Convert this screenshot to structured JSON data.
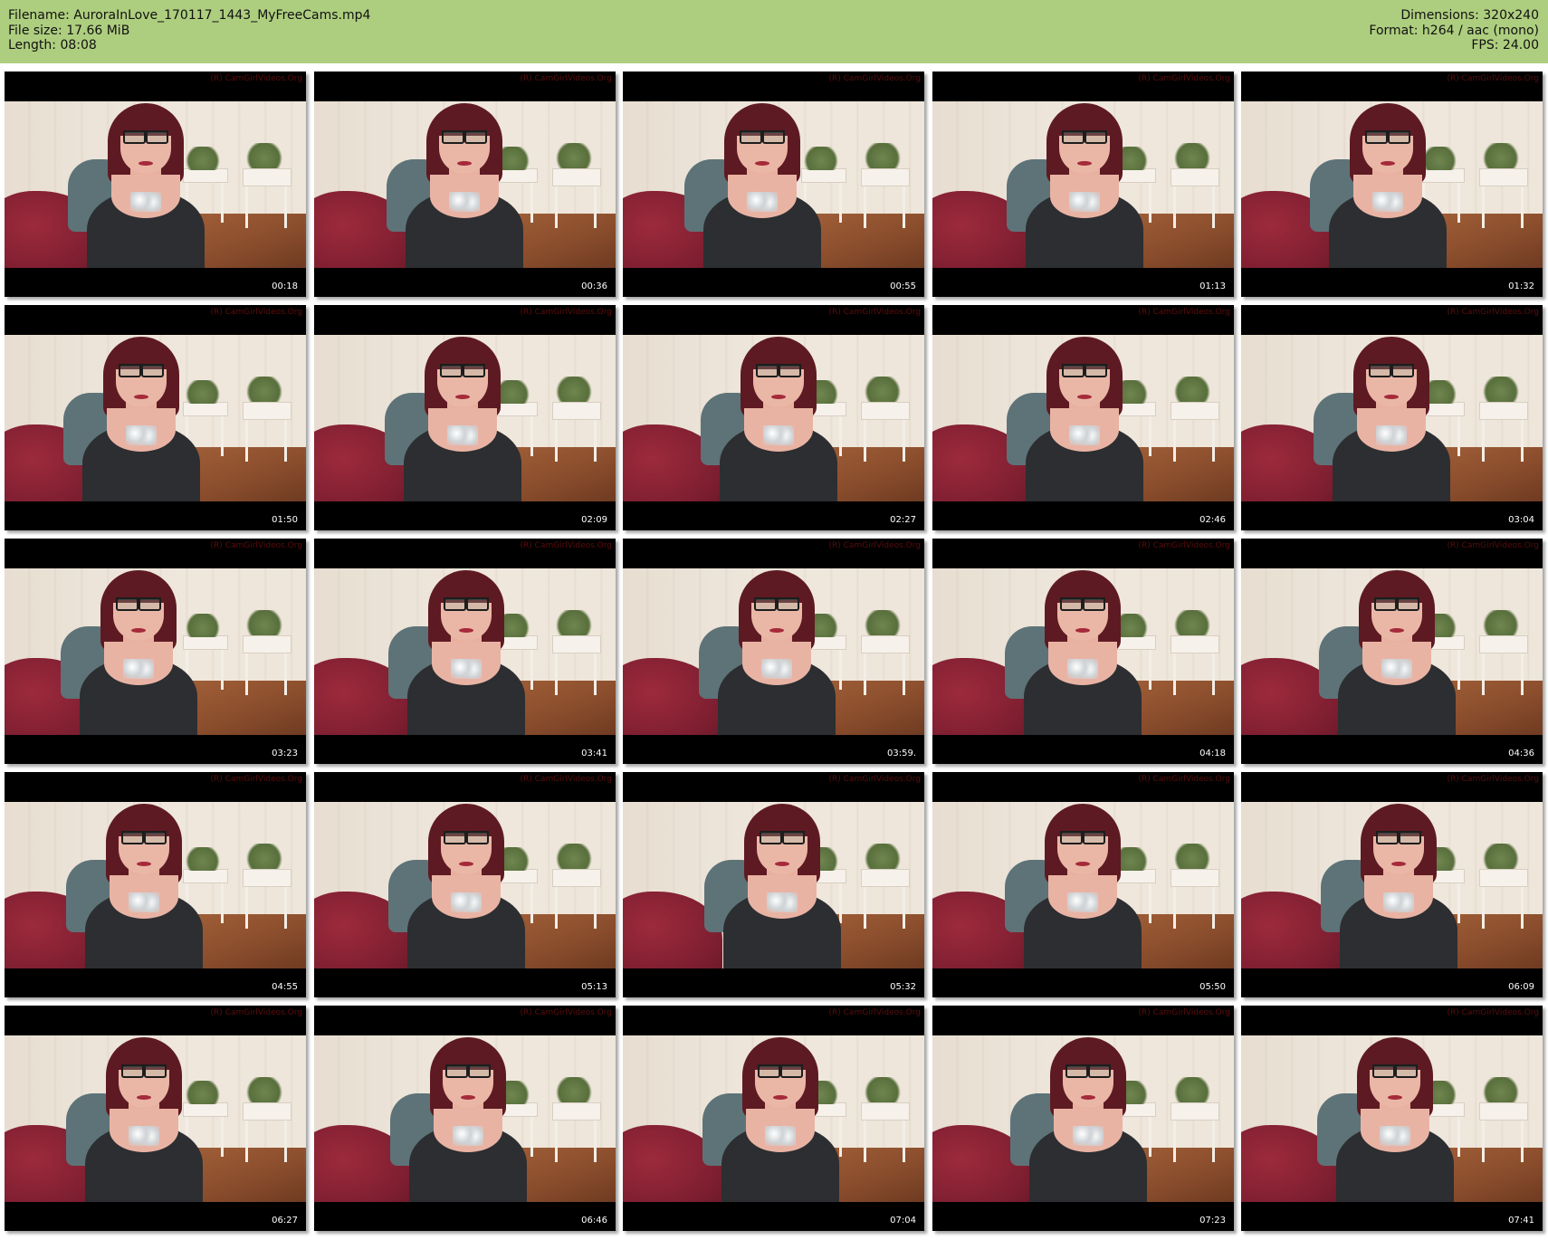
{
  "header": {
    "left": {
      "filename": "Filename: AuroraInLove_170117_1443_MyFreeCams.mp4",
      "filesize": "File size: 17.66 MiB",
      "length": "Length: 08:08"
    },
    "right": {
      "dimensions": "Dimensions: 320x240",
      "format": "Format: h264 / aac (mono)",
      "fps": "FPS: 24.00"
    },
    "background_color": "#aece7f"
  },
  "thumbnails": [
    {
      "time": "00:18",
      "watermark": "(R) CamGirlVideos.Org"
    },
    {
      "time": "00:36",
      "watermark": "(R) CamGirlVideos.Org"
    },
    {
      "time": "00:55",
      "watermark": "(R) CamGirlVideos.Org"
    },
    {
      "time": "01:13",
      "watermark": "(R) CamGirlVideos.Org"
    },
    {
      "time": "01:32",
      "watermark": "(R) CamGirlVideos.Org"
    },
    {
      "time": "01:50",
      "watermark": "(R) CamGirlVideos.Org"
    },
    {
      "time": "02:09",
      "watermark": "(R) CamGirlVideos.Org"
    },
    {
      "time": "02:27",
      "watermark": "(R) CamGirlVideos.Org"
    },
    {
      "time": "02:46",
      "watermark": "(R) CamGirlVideos.Org"
    },
    {
      "time": "03:04",
      "watermark": "(R) CamGirlVideos.Org"
    },
    {
      "time": "03:23",
      "watermark": "(R) CamGirlVideos.Org"
    },
    {
      "time": "03:41",
      "watermark": "(R) CamGirlVideos.Org"
    },
    {
      "time": "03:59.",
      "watermark": "(R) CamGirlVideos.Org"
    },
    {
      "time": "04:18",
      "watermark": "(R) CamGirlVideos.Org"
    },
    {
      "time": "04:36",
      "watermark": "(R) CamGirlVideos.Org"
    },
    {
      "time": "04:55",
      "watermark": "(R) CamGirlVideos.Org"
    },
    {
      "time": "05:13",
      "watermark": "(R) CamGirlVideos.Org"
    },
    {
      "time": "05:32",
      "watermark": "(R) CamGirlVideos.Org"
    },
    {
      "time": "05:50",
      "watermark": "(R) CamGirlVideos.Org"
    },
    {
      "time": "06:09",
      "watermark": "(R) CamGirlVideos.Org"
    },
    {
      "time": "06:27",
      "watermark": "(R) CamGirlVideos.Org"
    },
    {
      "time": "06:46",
      "watermark": "(R) CamGirlVideos.Org"
    },
    {
      "time": "07:04",
      "watermark": "(R) CamGirlVideos.Org"
    },
    {
      "time": "07:23",
      "watermark": "(R) CamGirlVideos.Org"
    },
    {
      "time": "07:41",
      "watermark": "(R) CamGirlVideos.Org"
    }
  ]
}
